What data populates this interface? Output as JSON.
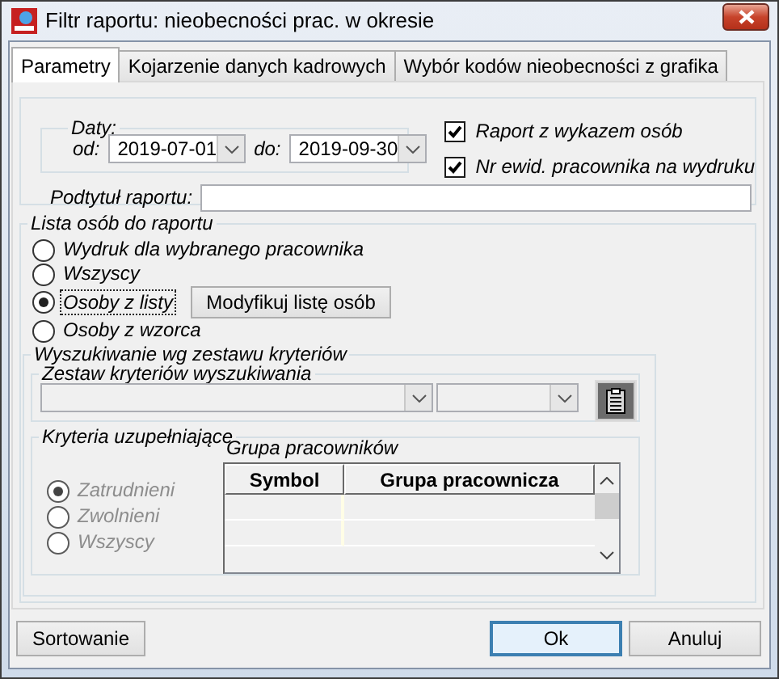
{
  "window": {
    "title": "Filtr raportu: nieobecności prac. w okresie"
  },
  "tabs": [
    {
      "label": "Parametry",
      "selected": true
    },
    {
      "label": "Kojarzenie danych kadrowych",
      "selected": false
    },
    {
      "label": "Wybór kodów nieobecności z grafika",
      "selected": false
    }
  ],
  "dates": {
    "title": "Daty:",
    "from_label": "od:",
    "from": "2019-07-01",
    "to_label": "do:",
    "to": "2019-09-30"
  },
  "options": [
    {
      "label": "Raport z wykazem osób",
      "checked": true
    },
    {
      "label": "Nr ewid. pracownika na wydruku",
      "checked": true
    }
  ],
  "subtitle": {
    "label": "Podtytuł raportu:"
  },
  "person_list": {
    "title": "Lista osób do raportu",
    "choices": [
      {
        "label": "Wydruk dla wybranego pracownika",
        "selected": false,
        "focused": false
      },
      {
        "label": "Wszyscy",
        "selected": false,
        "focused": false
      },
      {
        "label": "Osoby z listy",
        "selected": true,
        "focused": true,
        "button": "Modyfikuj listę osób"
      },
      {
        "label": "Osoby z wzorca",
        "selected": false,
        "focused": false
      }
    ]
  },
  "search": {
    "title": "Wyszukiwanie wg zestawu kryteriów",
    "set_title": "Zestaw kryteriów wyszukiwania",
    "supplementary": {
      "title": "Kryteria uzupełniające",
      "choices": [
        {
          "label": "Zatrudnieni",
          "selected": true,
          "disabled": true
        },
        {
          "label": "Zwolnieni",
          "selected": false,
          "disabled": true
        },
        {
          "label": "Wszyscy",
          "selected": false,
          "disabled": true
        }
      ],
      "group": {
        "title": "Grupa pracowników",
        "columns": [
          "Symbol",
          "Grupa pracownicza"
        ]
      }
    }
  },
  "buttons": [
    {
      "label": "Sortowanie",
      "default": false
    },
    {
      "label": "Ok",
      "default": true
    },
    {
      "label": "Anuluj",
      "default": false
    }
  ]
}
